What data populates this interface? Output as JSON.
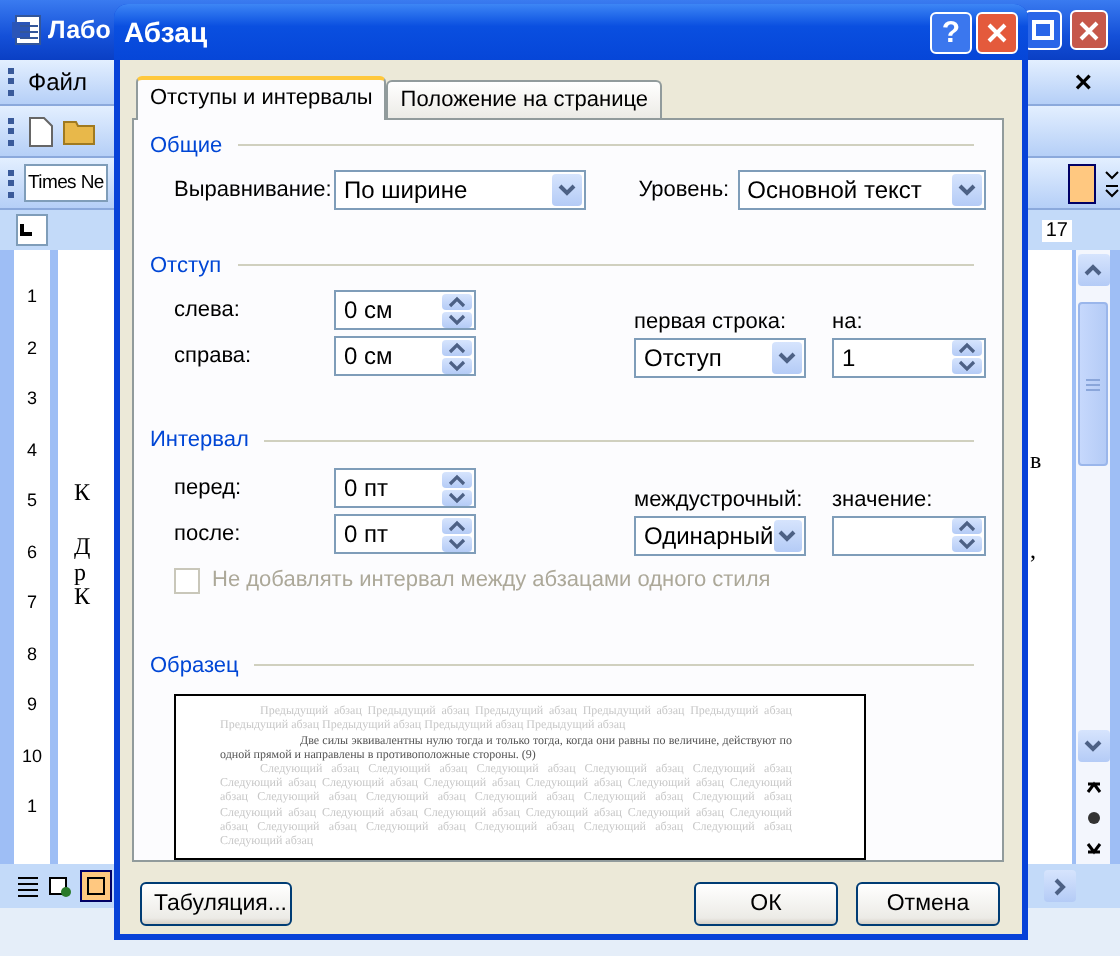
{
  "word_window": {
    "title": "Лабо",
    "menu": [
      {
        "label": "Файл"
      }
    ],
    "close_document": "×",
    "font_box": "Times Ne",
    "ruler_number": "17",
    "vertical_ruler": [
      "1",
      "2",
      "3",
      "4",
      "5",
      "6",
      "7",
      "8",
      "9",
      "10",
      "1"
    ],
    "text_left": [
      "К",
      "Д",
      "р",
      "К"
    ],
    "text_right": [
      "в",
      ","
    ]
  },
  "dialog": {
    "title": "Абзац",
    "help": "?",
    "tabs": [
      {
        "label": "Отступы и интервалы",
        "selected": true
      },
      {
        "label": "Положение на странице",
        "selected": false
      }
    ],
    "general": {
      "heading": "Общие",
      "alignment": {
        "label": "Выравнивание:",
        "value": "По ширине"
      },
      "level": {
        "label": "Уровень:",
        "value": "Основной текст"
      }
    },
    "indent": {
      "heading": "Отступ",
      "left": {
        "label": "слева:",
        "value": "0 см"
      },
      "right": {
        "label": "справа:",
        "value": "0 см"
      },
      "first_line": {
        "label": "первая строка:",
        "value": "Отступ"
      },
      "by": {
        "label": "на:",
        "value": "1"
      }
    },
    "spacing": {
      "heading": "Интервал",
      "before": {
        "label": "перед:",
        "value": "0 пт"
      },
      "after": {
        "label": "после:",
        "value": "0 пт"
      },
      "line_spacing": {
        "label": "междустрочный:",
        "value": "Одинарный"
      },
      "at": {
        "label": "значение:"
      },
      "no_space_checkbox": {
        "label": "Не добавлять интервал между абзацами одного стиля",
        "checked": false,
        "disabled": true
      }
    },
    "preview": {
      "heading": "Образец",
      "previous": "Предыдущий абзац Предыдущий абзац Предыдущий абзац Предыдущий абзац Предыдущий абзац Предыдущий абзац Предыдущий абзац Предыдущий абзац Предыдущий абзац",
      "sample": "Две силы эквивалентны нулю тогда и только тогда, когда они равны по величине, действуют по одной прямой и направлены в противоположные стороны. (9)",
      "following": "Следующий абзац Следующий абзац Следующий абзац Следующий абзац Следующий абзац Следующий абзац Следующий абзац Следующий абзац Следующий абзац Следующий абзац Следующий абзац Следующий абзац Следующий абзац Следующий абзац Следующий абзац Следующий абзац Следующий абзац Следующий абзац Следующий абзац Следующий абзац Следующий абзац Следующий абзац Следующий абзац Следующий абзац Следующий абзац Следующий абзац Следующий абзац Следующий абзац"
    },
    "buttons": [
      {
        "label": "Табуляция..."
      },
      {
        "label": "ОК"
      },
      {
        "label": "Отмена"
      }
    ]
  }
}
